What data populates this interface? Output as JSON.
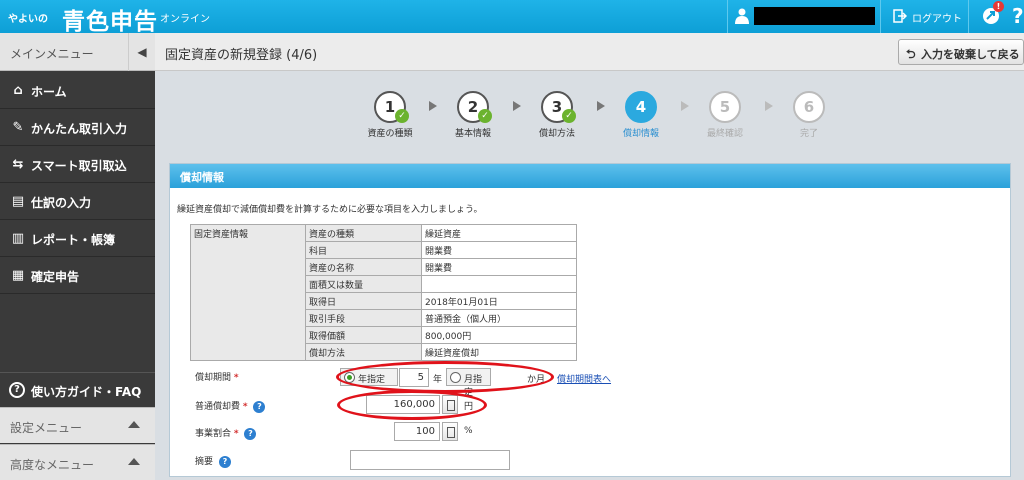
{
  "header": {
    "logo_small": "やよいの",
    "logo_main": "青色申告",
    "logo_sub": "オンライン",
    "logout_label": "ログアウト",
    "notice_count": "!",
    "help_label": "?"
  },
  "sidebar": {
    "title": "メインメニュー",
    "items": [
      {
        "label": "ホーム",
        "icon": "home-icon"
      },
      {
        "label": "かんたん取引入力",
        "icon": "pencil-icon"
      },
      {
        "label": "スマート取引取込",
        "icon": "import-icon"
      },
      {
        "label": "仕訳の入力",
        "icon": "journal-icon"
      },
      {
        "label": "レポート・帳簿",
        "icon": "report-icon"
      },
      {
        "label": "確定申告",
        "icon": "tax-icon"
      }
    ],
    "faq_label": "使い方ガイド・FAQ",
    "settings_label": "設定メニュー",
    "advanced_label": "高度なメニュー"
  },
  "page": {
    "title": "固定資産の新規登録 (4/6)",
    "discard_label": "入力を破棄して戻る"
  },
  "steps": [
    {
      "num": "1",
      "label": "資産の種類",
      "state": "done"
    },
    {
      "num": "2",
      "label": "基本情報",
      "state": "done"
    },
    {
      "num": "3",
      "label": "償却方法",
      "state": "done"
    },
    {
      "num": "4",
      "label": "償却情報",
      "state": "active"
    },
    {
      "num": "5",
      "label": "最終確認",
      "state": "future"
    },
    {
      "num": "6",
      "label": "完了",
      "state": "future"
    }
  ],
  "panel": {
    "title": "償却情報",
    "intro": "繰延資産償却で減価償却費を計算するために必要な項目を入力しましょう。",
    "group_label": "固定資産情報",
    "rows": [
      {
        "key": "資産の種類",
        "value": "繰延資産"
      },
      {
        "key": "科目",
        "value": "開業費"
      },
      {
        "key": "資産の名称",
        "value": "開業費"
      },
      {
        "key": "面積又は数量",
        "value": ""
      },
      {
        "key": "取得日",
        "value": "2018年01月01日"
      },
      {
        "key": "取引手段",
        "value": "普通預金（個人用）"
      },
      {
        "key": "取得価額",
        "value": "800,000円"
      },
      {
        "key": "償却方法",
        "value": "繰延資産償却"
      }
    ]
  },
  "form": {
    "period_label": "償却期間",
    "period_radio_year": "年指定",
    "period_value": "5",
    "period_unit_year": "年",
    "period_radio_month": "月指定",
    "period_unit_month": "か月",
    "period_link": "償却期間表へ",
    "depreciation_label": "普通償却費",
    "depreciation_value": "160,000",
    "depreciation_unit": "円",
    "ratio_label": "事業割合",
    "ratio_value": "100",
    "ratio_unit": "%",
    "memo_label": "摘要",
    "required_mark": "*",
    "help_mark": "?"
  },
  "colors": {
    "brand": "#0d9fd6",
    "active_step": "#2ba9df",
    "check": "#6bb32e",
    "annotation": "#e0121a"
  }
}
